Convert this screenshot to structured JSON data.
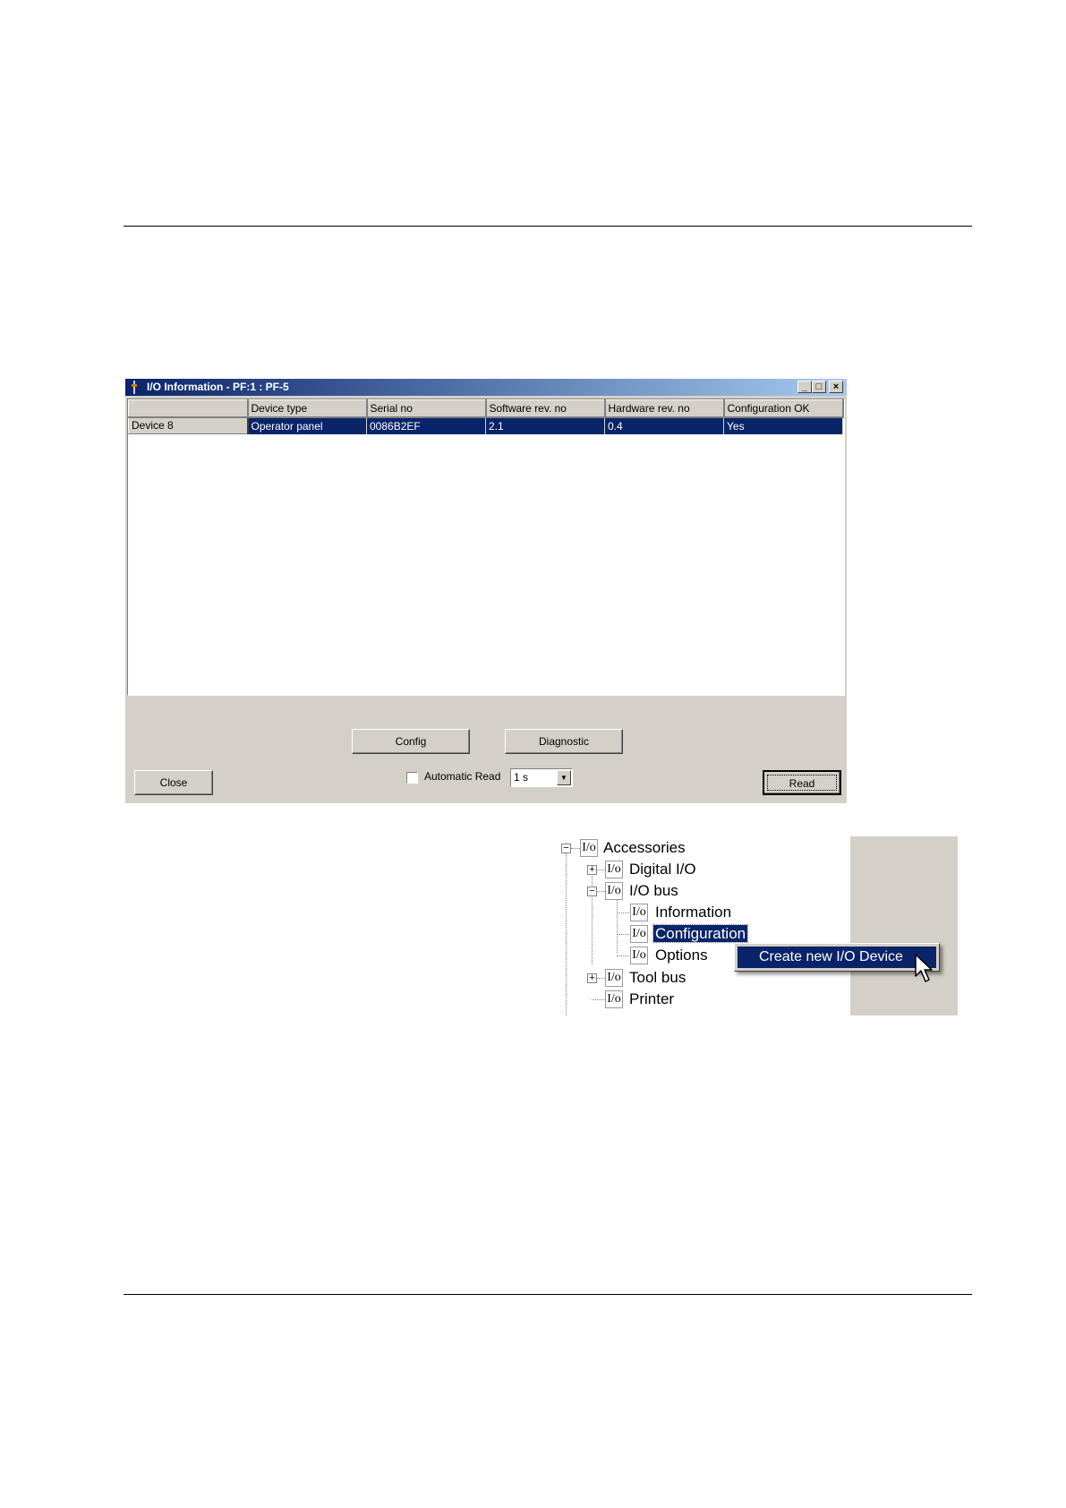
{
  "dialog": {
    "title": "I/O Information - PF:1 : PF-5",
    "window_buttons": {
      "minimize": "_",
      "maximize": "□",
      "close": "×"
    },
    "columns": [
      "",
      "Device type",
      "Serial no",
      "Software rev. no",
      "Hardware rev. no",
      "Configuration OK"
    ],
    "rows": [
      {
        "header": "Device 8",
        "cells": [
          "Operator panel",
          "0086B2EF",
          "2.1",
          "0.4",
          "Yes"
        ]
      }
    ],
    "buttons": {
      "config": "Config",
      "diagnostic": "Diagnostic",
      "close": "Close",
      "read": "Read"
    },
    "automatic_read_label": "Automatic Read",
    "automatic_read_checked": false,
    "interval_value": "1 s"
  },
  "tree": {
    "io_glyph": "I/o",
    "nodes": [
      {
        "label": "Accessories",
        "expander": "−"
      },
      {
        "label": "Digital I/O",
        "expander": "+"
      },
      {
        "label": "I/O bus",
        "expander": "−"
      },
      {
        "label": "Information"
      },
      {
        "label": "Configuration",
        "selected": true
      },
      {
        "label": "Options"
      },
      {
        "label": "Tool bus",
        "expander": "+"
      },
      {
        "label": "Printer"
      }
    ],
    "context_menu": {
      "item": "Create new I/O Device"
    }
  },
  "colors": {
    "selection": "#0a246a",
    "face": "#d4d0c8",
    "title_gradient_end": "#a6caf0"
  }
}
